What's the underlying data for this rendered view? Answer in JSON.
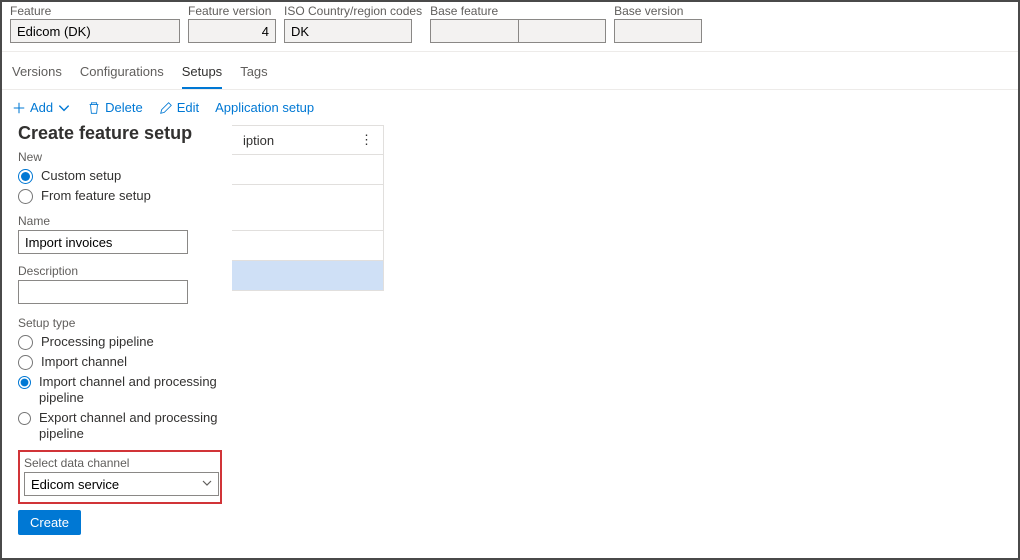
{
  "header": {
    "feature_label": "Feature",
    "feature_value": "Edicom (DK)",
    "feature_version_label": "Feature version",
    "feature_version_value": "4",
    "iso_label": "ISO Country/region codes",
    "iso_value": "DK",
    "base_feature_label": "Base feature",
    "base_feature_value": "",
    "base_version_label": "Base version",
    "base_version_value": ""
  },
  "tabs": {
    "versions": "Versions",
    "configurations": "Configurations",
    "setups": "Setups",
    "tags": "Tags"
  },
  "toolbar": {
    "add": "Add",
    "delete": "Delete",
    "edit": "Edit",
    "app_setup": "Application setup"
  },
  "grid": {
    "col_description_partial": "iption",
    "ellipsis": "⋮"
  },
  "panel": {
    "title": "Create feature setup",
    "new_section": "New",
    "radio_custom": "Custom setup",
    "radio_from_feature": "From feature setup",
    "name_label": "Name",
    "name_value": "Import invoices",
    "description_label": "Description",
    "description_value": "",
    "setup_type_label": "Setup type",
    "radio_processing": "Processing pipeline",
    "radio_import_channel": "Import channel",
    "radio_import_proc": "Import channel and processing pipeline",
    "radio_export_proc": "Export channel and processing pipeline",
    "select_channel_label": "Select data channel",
    "select_channel_value": "Edicom service",
    "create_button": "Create"
  }
}
